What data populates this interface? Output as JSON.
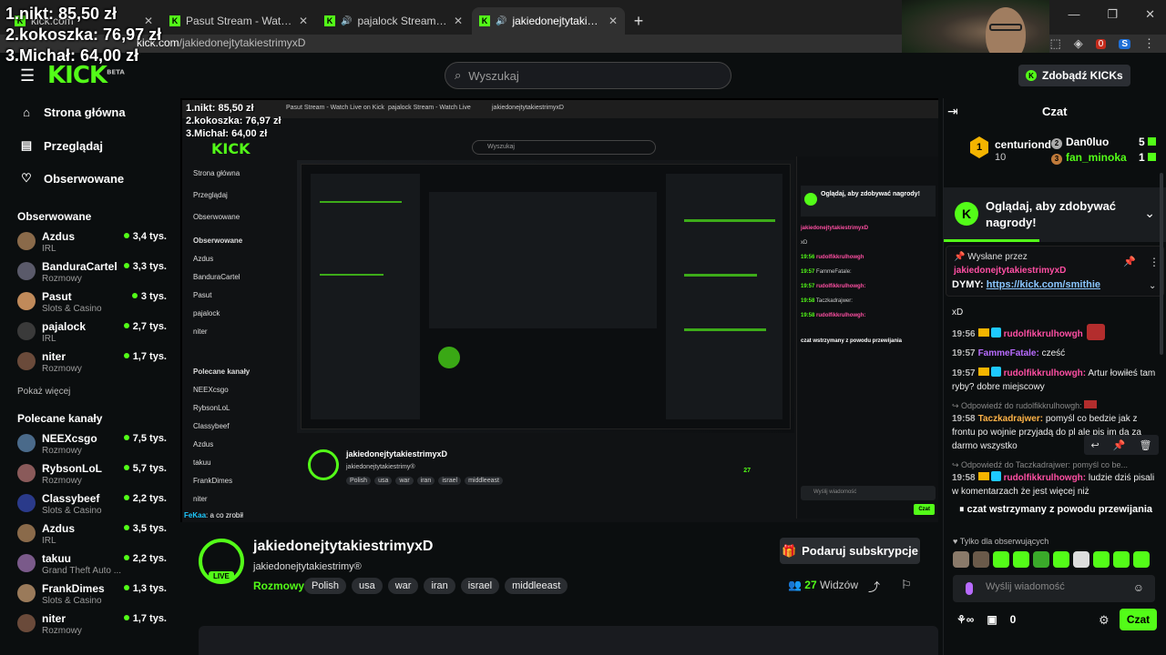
{
  "overlay": {
    "ranking": [
      "1.nikt: 85,50 zł",
      "2.kokoszka: 76,97 zł",
      "3.Michał: 64,00 zł"
    ]
  },
  "browser": {
    "tabs": [
      {
        "title": "kick.com",
        "active": false
      },
      {
        "title": "Pasut Stream - Watch Live on Kick",
        "active": false
      },
      {
        "title": "pajalock Stream - Watch Live on Kick",
        "active": false
      },
      {
        "title": "jakiedonejtytakiestrimyxD Stream",
        "active": true
      }
    ],
    "url_host": "kick.com",
    "url_path": "/jakiedonejtytakiestrimyxD",
    "new_tab": "+",
    "badge_count": "0"
  },
  "header": {
    "logo": "KICK",
    "logo_beta": "BETA",
    "search_placeholder": "Wyszukaj",
    "kicks_button": "Zdobądź KICKs"
  },
  "sidebar": {
    "nav": [
      {
        "label": "Strona główna",
        "icon": "home-icon"
      },
      {
        "label": "Przeglądaj",
        "icon": "browse-icon"
      },
      {
        "label": "Obserwowane",
        "icon": "heart-icon"
      }
    ],
    "followed_title": "Obserwowane",
    "followed": [
      {
        "name": "Azdus",
        "category": "IRL",
        "viewers": "3,4 tys.",
        "color": "#8a6a4a"
      },
      {
        "name": "BanduraCartel",
        "category": "Rozmowy",
        "viewers": "3,3 tys.",
        "color": "#5a5a6a"
      },
      {
        "name": "Pasut",
        "category": "Slots & Casino",
        "viewers": "3 tys.",
        "color": "#c08a5a"
      },
      {
        "name": "pajalock",
        "category": "IRL",
        "viewers": "2,7 tys.",
        "color": "#3a3a3a"
      },
      {
        "name": "niter",
        "category": "Rozmowy",
        "viewers": "1,7 tys.",
        "color": "#6a4a3a"
      }
    ],
    "show_more": "Pokaż więcej",
    "recommended_title": "Polecane kanały",
    "recommended": [
      {
        "name": "NEEXcsgo",
        "category": "Rozmowy",
        "viewers": "7,5 tys.",
        "color": "#4a6a8a"
      },
      {
        "name": "RybsonLoL",
        "category": "Rozmowy",
        "viewers": "5,7 tys.",
        "color": "#8a5a5a"
      },
      {
        "name": "Classybeef",
        "category": "Slots & Casino",
        "viewers": "2,2 tys.",
        "color": "#2a3a8a"
      },
      {
        "name": "Azdus",
        "category": "IRL",
        "viewers": "3,5 tys.",
        "color": "#8a6a4a"
      },
      {
        "name": "takuu",
        "category": "Grand Theft Auto ...",
        "viewers": "2,2 tys.",
        "color": "#7a5a8a"
      },
      {
        "name": "FrankDimes",
        "category": "Slots & Casino",
        "viewers": "1,3 tys.",
        "color": "#9a7a5a"
      },
      {
        "name": "niter",
        "category": "Rozmowy",
        "viewers": "1,7 tys.",
        "color": "#6a4a3a"
      }
    ]
  },
  "player": {
    "fekaa_user": "FeKaa",
    "fekaa_text": ": a co zrobił"
  },
  "stream": {
    "live_badge": "LIVE",
    "title": "jakiedonejtytakiestrimyxD",
    "subtitle": "jakiedonejtytakiestrimy®",
    "category": "Rozmowy",
    "tags": [
      "Polish",
      "usa",
      "war",
      "iran",
      "israel",
      "middleeast"
    ],
    "subscribe": "Podaruj subskrypcje",
    "viewers_count": "27",
    "viewers_label": "Widzów"
  },
  "chat": {
    "title": "Czat",
    "leaders": [
      {
        "rank": "1",
        "name": "centuriond",
        "count": "10"
      },
      {
        "rank": "2",
        "name": "Dan0luo",
        "count": "5"
      },
      {
        "rank": "3",
        "name": "fan_minoka",
        "count": "1"
      }
    ],
    "promo": "Oglądaj, aby zdobywać nagrody!",
    "pinned": {
      "header": "Wysłane przez",
      "author": "jakiedonejtytakiestrimyxD",
      "text": "DYMY: ",
      "link": "https://kick.com/smithie"
    },
    "messages": [
      {
        "time": "",
        "user": "",
        "color": "#fff",
        "text": "xD"
      },
      {
        "time": "19:56",
        "user": "rudolfikkrulhowgh",
        "color": "#ff4fa3",
        "text": ""
      },
      {
        "time": "19:57",
        "user": "FammeFatale:",
        "color": "#b86bff",
        "text": " cześć"
      },
      {
        "time": "19:57",
        "user": "rudolfikkrulhowgh:",
        "color": "#ff4fa3",
        "text": " Artur łowiłeś tam ryby? dobre miejscowy"
      },
      {
        "time": "19:58",
        "user": "Taczkadrajwer:",
        "color": "#ffb347",
        "text": " pomyśl co bedzie jak z frontu po wojnie przyjadą do pl ale pis im da za darmo wszystko"
      },
      {
        "time": "19:58",
        "user": "rudolfikkrulhowgh:",
        "color": "#ff4fa3",
        "text": " ludzie dziś pisali w komentarzach że jest więcej niż"
      }
    ],
    "reply1": "Odpowiedź do rudolfikkrulhowgh:",
    "reply2": "Odpowiedź do Taczkadrajwer: pomyśl co be...",
    "paused": "czat wstrzymany z powodu przewijania",
    "followers_only": "Tylko dla obserwujących",
    "input_placeholder": "Wyślij wiadomość",
    "foot_count": "0",
    "send": "Czat"
  }
}
